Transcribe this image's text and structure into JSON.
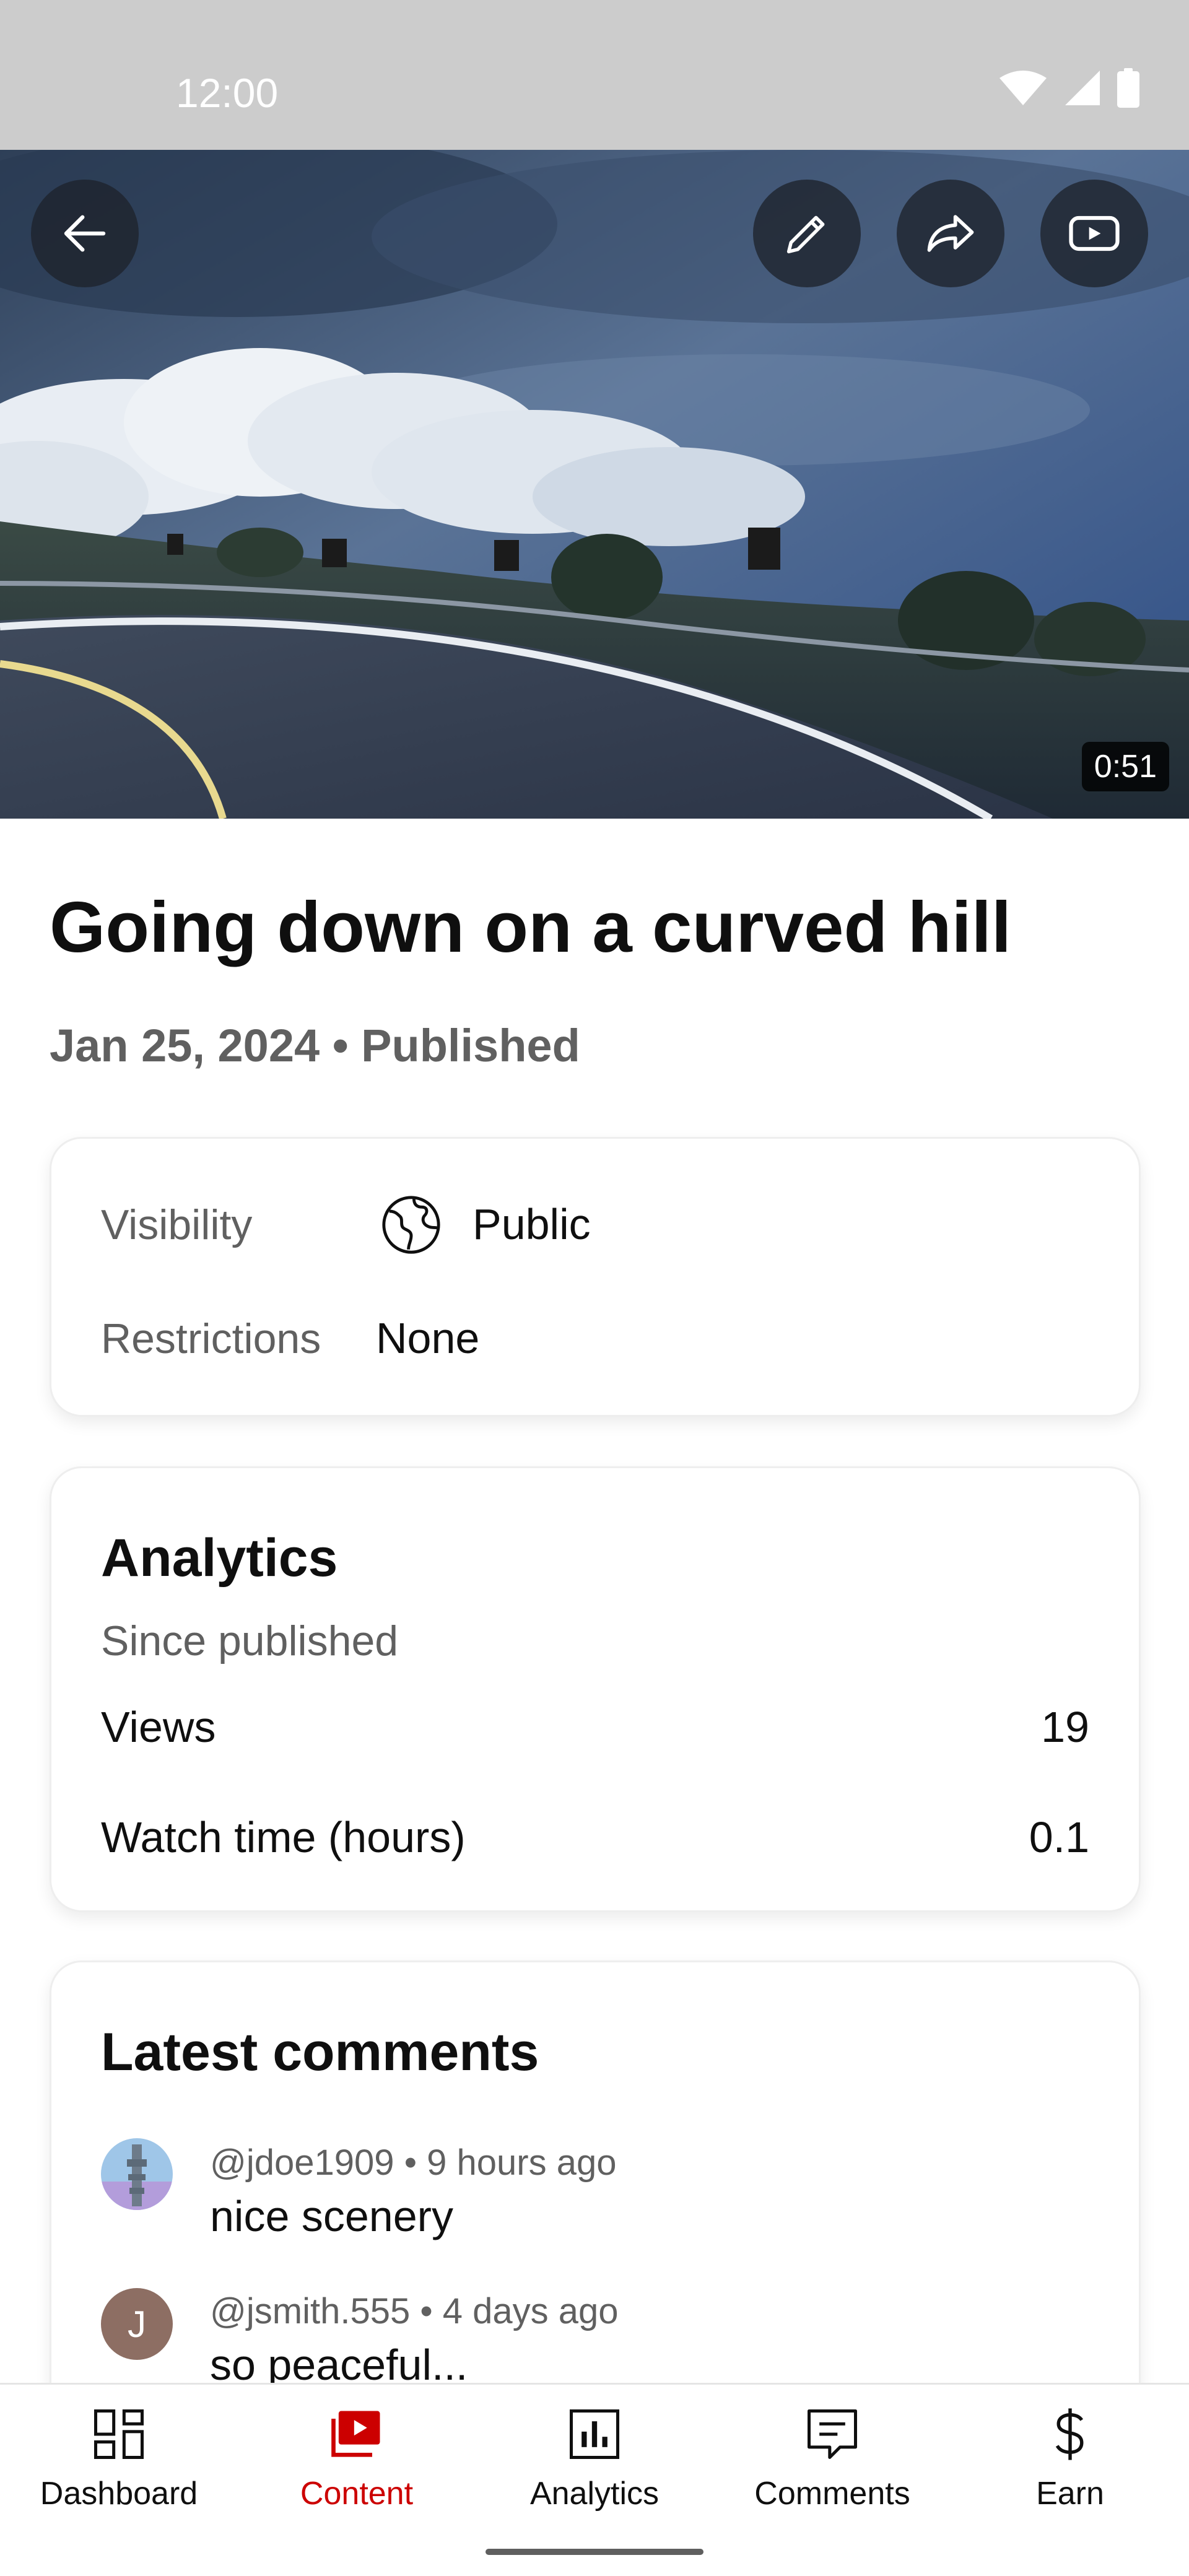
{
  "status_bar": {
    "time": "12:00",
    "icons": [
      "wifi-icon",
      "signal-icon",
      "battery-icon"
    ]
  },
  "video": {
    "duration": "0:51",
    "title": "Going down on a curved hill",
    "date": "Jan 25, 2024",
    "separator": "•",
    "status": "Published",
    "toolbar_icons": [
      "back-arrow-icon",
      "edit-pencil-icon",
      "share-icon",
      "youtube-play-icon"
    ]
  },
  "details": {
    "visibility_label": "Visibility",
    "visibility_value": "Public",
    "visibility_icon": "globe-icon",
    "restrictions_label": "Restrictions",
    "restrictions_value": "None"
  },
  "analytics": {
    "title": "Analytics",
    "subtitle": "Since published",
    "rows": [
      {
        "label": "Views",
        "value": "19"
      },
      {
        "label": "Watch time (hours)",
        "value": "0.1"
      }
    ]
  },
  "comments": {
    "title": "Latest comments",
    "items": [
      {
        "author": "@jdoe1909",
        "time": "9 hours ago",
        "text": "nice scenery",
        "avatar_letter": ""
      },
      {
        "author": "@jsmith.555",
        "time": "4 days ago",
        "text": "so peaceful...",
        "avatar_letter": "J",
        "avatar_color": "#8d6e63"
      }
    ]
  },
  "bottom_nav": {
    "items": [
      {
        "label": "Dashboard",
        "icon": "dashboard-icon",
        "active": false
      },
      {
        "label": "Content",
        "icon": "content-icon",
        "active": true
      },
      {
        "label": "Analytics",
        "icon": "analytics-icon",
        "active": false
      },
      {
        "label": "Comments",
        "icon": "comments-icon",
        "active": false
      },
      {
        "label": "Earn",
        "icon": "dollar-icon",
        "active": false
      }
    ]
  },
  "colors": {
    "accent": "#cc0000",
    "text_primary": "#0f0f0f",
    "text_secondary": "#606060",
    "status_bar": "#cccccc"
  }
}
